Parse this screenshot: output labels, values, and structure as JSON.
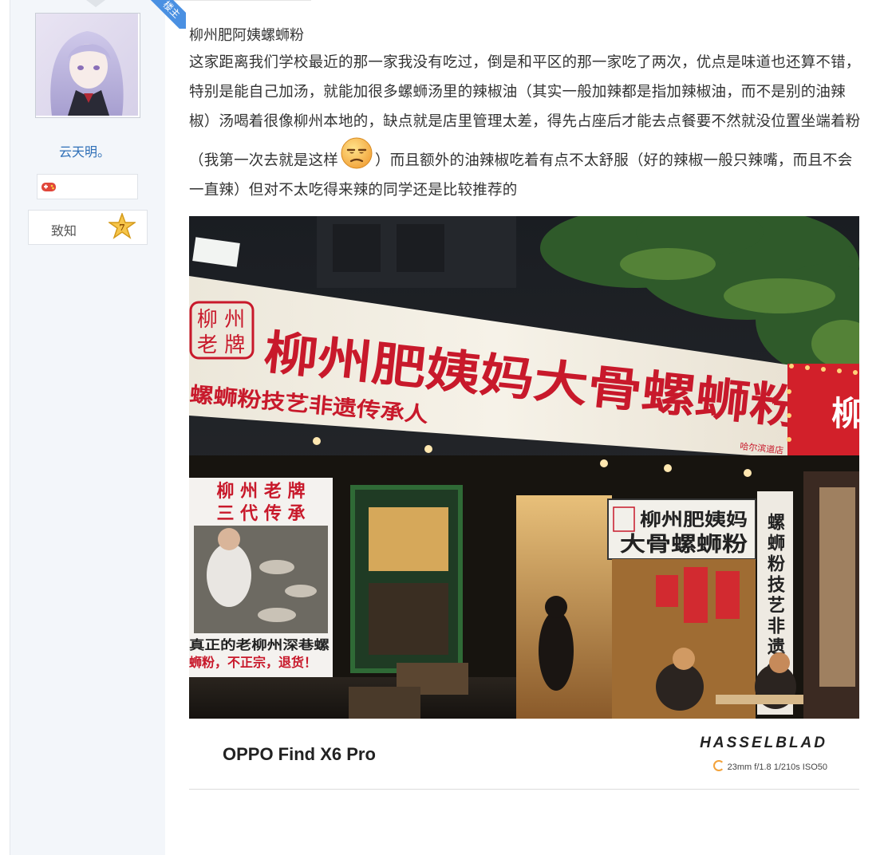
{
  "author": {
    "username": "云天明。",
    "ribbon_label": "楼主",
    "level_label": "致知",
    "level_number": "7"
  },
  "post": {
    "title": "柳州肥阿姨螺蛳粉",
    "text_before_emoji": "这家距离我们学校最近的那一家我没有吃过，倒是和平区的那一家吃了两次，优点是味道也还算不错，特别是能自己加汤，就能加很多螺蛳汤里的辣椒油（其实一般加辣都是指加辣椒油，而不是别的油辣椒）汤喝着很像柳州本地的，缺点就是店里管理太差，得先占座后才能去点餐要不然就没位置坐端着粉（我第一次去就是这样",
    "text_after_emoji": "）而且额外的油辣椒吃着有点不太舒服（好的辣椒一般只辣嘴，而且不会一直辣）但对不太吃得来辣的同学还是比较推荐的",
    "emoji": "unamused-face-emoji"
  },
  "photo": {
    "sign_badge_top": "柳 州",
    "sign_badge_bottom": "老 牌",
    "sign_main": "柳州肥姨妈大骨螺蛳粉",
    "sign_sub": "螺蛳粉技艺非遗传承人",
    "sign_branch": "哈尔滨道店",
    "poster_line1": "柳 州 老 牌",
    "poster_line2": "三 代 传 承",
    "poster_bottom1": "真正的老柳州深巷螺",
    "poster_bottom2": "蛳粉，不正宗，退货！",
    "window_sign_line1": "柳州肥姨妈",
    "window_sign_line2": "大骨螺蛳粉",
    "vertical_banner": "螺蛳粉技艺非遗传承",
    "right_sign_char": "柳",
    "camera_model": "OPPO Find X6 Pro",
    "camera_brand": "HASSELBLAD",
    "camera_specs": "23mm f/1.8 1/210s ISO50"
  },
  "colors": {
    "link": "#2e6fb7",
    "ribbon": "#4a90e2",
    "sign_red": "#c8192b"
  }
}
